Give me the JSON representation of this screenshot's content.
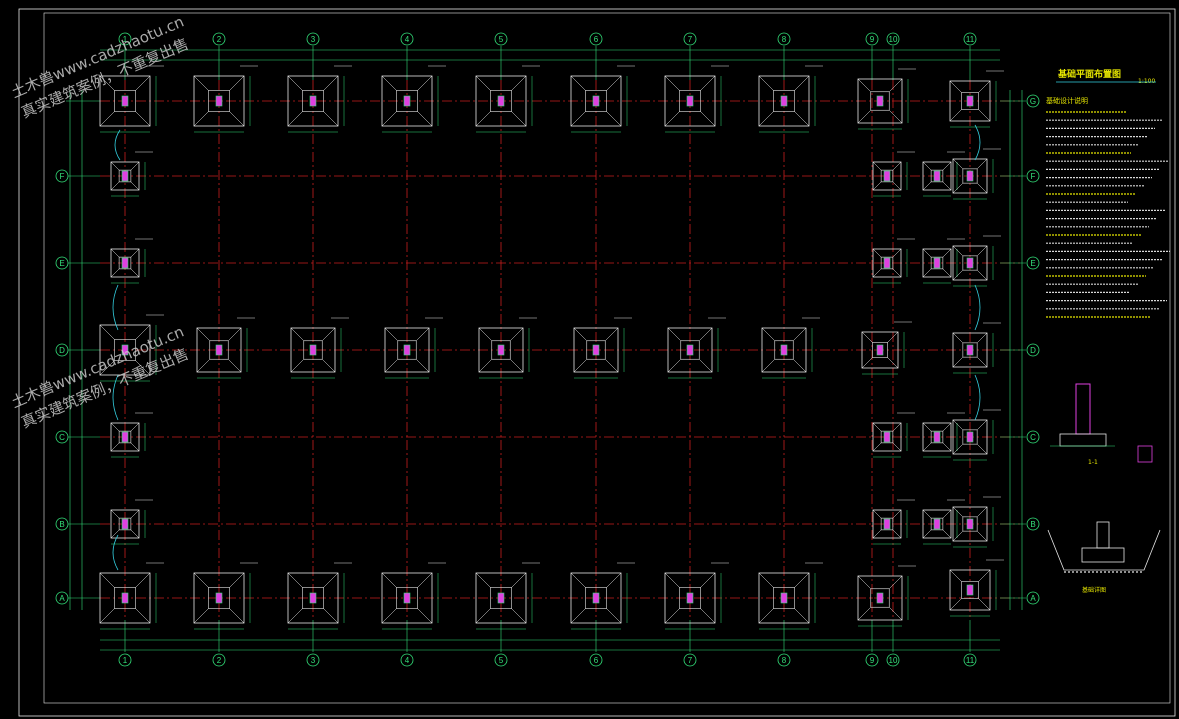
{
  "colors": {
    "background": "#000000",
    "axis_green": "#33e07a",
    "grid_red": "#c81e1e",
    "footing_white": "#e8e8e8",
    "column_magenta": "#e040e0",
    "highlight_yellow": "#e6e600",
    "cyan": "#33d0e0"
  },
  "drawing": {
    "column_axes_top": [
      "1",
      "2",
      "3",
      "4",
      "5",
      "6",
      "7",
      "8",
      "9",
      "10",
      "11"
    ],
    "row_axes_right": [
      "G",
      "F",
      "E",
      "D",
      "C",
      "B",
      "A"
    ],
    "row_axes_left": [
      "F",
      "E",
      "D",
      "C",
      "B",
      "A"
    ],
    "notes_title": "基础平面布置图",
    "notes_title_suffix": "1:100",
    "notes_heading": "基础设计说明",
    "section_label": "1-1",
    "detail_title": "基础详图",
    "icon": "cad-drawing"
  },
  "watermark": {
    "line1": "土木兽www.cadzhaotu.cn",
    "line2": "真实建筑案例，不重复出售"
  }
}
